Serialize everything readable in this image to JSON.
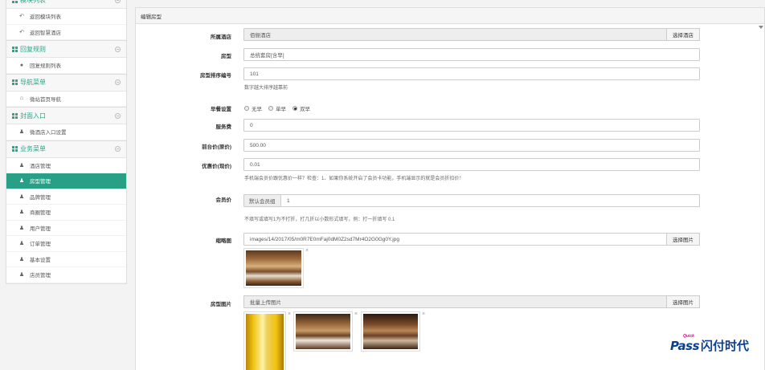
{
  "sidebar": {
    "groups": [
      {
        "title": "模块列表",
        "items": [
          {
            "icon": "back-icon",
            "glyph": "↶",
            "label": "返回模块列表"
          },
          {
            "icon": "back-icon",
            "glyph": "↶",
            "label": "返回智慧酒店"
          }
        ]
      },
      {
        "title": "回复规则",
        "items": [
          {
            "icon": "comments-icon",
            "glyph": "●",
            "label": "回复规则列表"
          }
        ]
      },
      {
        "title": "导航菜单",
        "items": [
          {
            "icon": "home-icon",
            "glyph": "⌂",
            "label": "微站首页导航"
          }
        ]
      },
      {
        "title": "封面入口",
        "items": [
          {
            "icon": "user-icon",
            "glyph": "♟",
            "label": "微酒店入口设置"
          }
        ]
      },
      {
        "title": "业务菜单",
        "items": [
          {
            "icon": "user-icon",
            "glyph": "♟",
            "label": "酒店管理"
          },
          {
            "icon": "user-icon",
            "glyph": "♟",
            "label": "房型管理",
            "active": true
          },
          {
            "icon": "user-icon",
            "glyph": "♟",
            "label": "品牌管理"
          },
          {
            "icon": "user-icon",
            "glyph": "♟",
            "label": "商圈管理"
          },
          {
            "icon": "user-icon",
            "glyph": "♟",
            "label": "用户管理"
          },
          {
            "icon": "user-icon",
            "glyph": "♟",
            "label": "订单管理"
          },
          {
            "icon": "user-icon",
            "glyph": "♟",
            "label": "基本设置"
          },
          {
            "icon": "user-icon",
            "glyph": "♟",
            "label": "店员管理"
          }
        ]
      }
    ]
  },
  "panel": {
    "heading": "编辑房型",
    "hotel": {
      "label": "所属酒店",
      "value": "佰俪酒店",
      "button": "选择酒店"
    },
    "room_type": {
      "label": "房型",
      "value": "总统套房[含早]"
    },
    "sort": {
      "label": "房型排序编号",
      "value": "101",
      "help": "数字越大排序越靠前"
    },
    "breakfast": {
      "label": "早餐设置",
      "options": [
        "无早",
        "单早",
        "双早"
      ],
      "selected": 2
    },
    "service_fee": {
      "label": "服务费",
      "value": "0"
    },
    "front_price": {
      "label": "前台价(原价)",
      "value": "500.00"
    },
    "discount_price": {
      "label": "优惠价(现价)",
      "value": "0.01",
      "help": "手机端会员价跟优惠价一样？检查：1、如果你系统开启了会员卡功能，手机端显示的就是会员折扣价！"
    },
    "member_price": {
      "label": "会员价",
      "group": "默认会员组",
      "value": "1",
      "help": "不填写或填写1为不打折，打几折以小数形式填写，例：打一折填写 0.1"
    },
    "thumb": {
      "label": "缩略图",
      "value": "images/14/2017/05/m0R7E0mFaj0dM0Z2sd7Mr4O2G0Gg0Y.jpg",
      "button": "选择图片"
    },
    "photos": {
      "label": "房型图片",
      "value": "批量上传图片",
      "button": "选择图片"
    },
    "close_glyph": "×"
  },
  "logo": {
    "quick": "Quick",
    "pass": "Pass",
    "cn": "闪付时代"
  },
  "colors": {
    "accent": "#27a085",
    "logo": "#0d3f8f"
  }
}
